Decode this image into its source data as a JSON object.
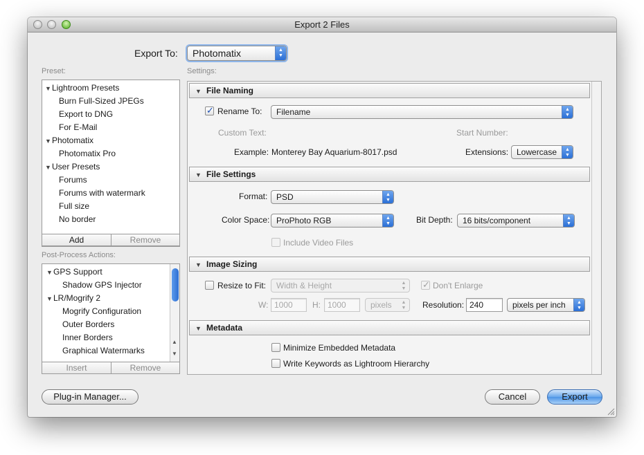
{
  "window": {
    "title": "Export 2 Files"
  },
  "export_to": {
    "label": "Export To:",
    "value": "Photomatix"
  },
  "preset": {
    "header": "Preset:",
    "items": [
      {
        "label": "Lightroom Presets",
        "kind": "group"
      },
      {
        "label": "Burn Full-Sized JPEGs",
        "kind": "item"
      },
      {
        "label": "Export to DNG",
        "kind": "item"
      },
      {
        "label": "For E-Mail",
        "kind": "item"
      },
      {
        "label": "Photomatix",
        "kind": "group"
      },
      {
        "label": "Photomatix Pro",
        "kind": "item"
      },
      {
        "label": "User Presets",
        "kind": "group"
      },
      {
        "label": "Forums",
        "kind": "item"
      },
      {
        "label": "Forums with watermark",
        "kind": "item"
      },
      {
        "label": "Full size",
        "kind": "item"
      },
      {
        "label": "No border",
        "kind": "item"
      }
    ],
    "add_label": "Add",
    "remove_label": "Remove"
  },
  "post_process": {
    "header": "Post-Process Actions:",
    "items": [
      {
        "label": "GPS Support",
        "kind": "group"
      },
      {
        "label": "Shadow GPS Injector",
        "kind": "item"
      },
      {
        "label": "LR/Mogrify 2",
        "kind": "group"
      },
      {
        "label": "Mogrify Configuration",
        "kind": "item"
      },
      {
        "label": "Outer Borders",
        "kind": "item"
      },
      {
        "label": "Inner Borders",
        "kind": "item"
      },
      {
        "label": "Graphical Watermarks",
        "kind": "item"
      }
    ],
    "insert_label": "Insert",
    "remove_label": "Remove"
  },
  "settings": {
    "header": "Settings:",
    "file_naming": {
      "title": "File Naming",
      "rename_label": "Rename To:",
      "rename_checked": true,
      "rename_value": "Filename",
      "custom_text_label": "Custom Text:",
      "start_number_label": "Start Number:",
      "example_label": "Example:",
      "example_value": "Monterey Bay Aquarium-8017.psd",
      "extensions_label": "Extensions:",
      "extensions_value": "Lowercase"
    },
    "file_settings": {
      "title": "File Settings",
      "format_label": "Format:",
      "format_value": "PSD",
      "color_space_label": "Color Space:",
      "color_space_value": "ProPhoto RGB",
      "bit_depth_label": "Bit Depth:",
      "bit_depth_value": "16 bits/component",
      "include_video_label": "Include Video Files",
      "include_video_checked": false
    },
    "image_sizing": {
      "title": "Image Sizing",
      "resize_label": "Resize to Fit:",
      "resize_checked": false,
      "resize_mode": "Width & Height",
      "dont_enlarge_label": "Don't Enlarge",
      "dont_enlarge_checked": true,
      "w_label": "W:",
      "w_value": "1000",
      "h_label": "H:",
      "h_value": "1000",
      "unit_value": "pixels",
      "resolution_label": "Resolution:",
      "resolution_value": "240",
      "resolution_unit": "pixels per inch"
    },
    "metadata": {
      "title": "Metadata",
      "minimize_label": "Minimize Embedded Metadata",
      "minimize_checked": false,
      "keywords_label": "Write Keywords as Lightroom Hierarchy",
      "keywords_checked": false
    }
  },
  "buttons": {
    "plugin_manager": "Plug-in Manager...",
    "cancel": "Cancel",
    "export": "Export"
  },
  "icons": {
    "popup_arrows": "▲▼",
    "disclosure_open": "▼",
    "scroll_up": "▲",
    "scroll_down": "▼",
    "resize_grip": "resize-grip"
  },
  "colors": {
    "accent": "#3d86e6",
    "window_bg": "#ececec"
  }
}
